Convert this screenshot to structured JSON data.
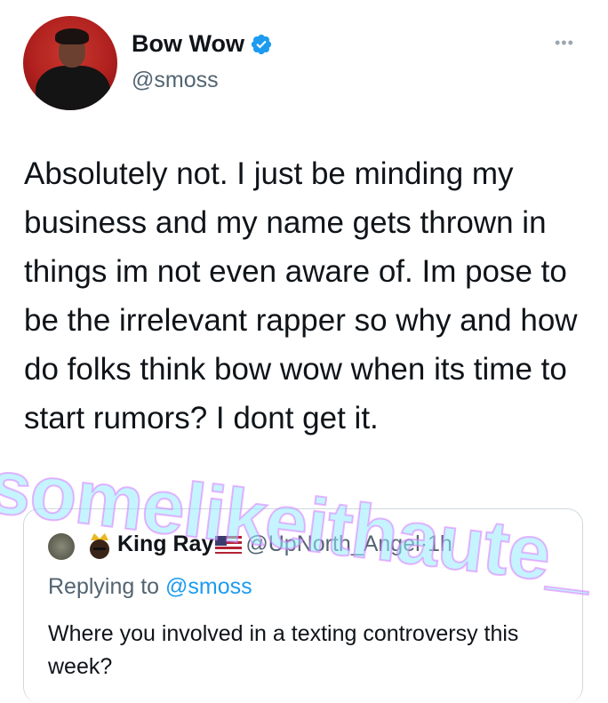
{
  "tweet": {
    "author_name": "Bow Wow",
    "author_handle": "@smoss",
    "verified": true,
    "more_icon": "more-horizontal-icon",
    "text": "Absolutely not. I just be minding my business and my name gets thrown in things im not even aware of. Im pose to be the irrelevant rapper so why and how do folks think bow wow when its time to start rumors? I dont get it."
  },
  "quoted_tweet": {
    "author_name": "King Ray",
    "flag_icon": "us-flag-icon",
    "author_handle": "@UpNorth_Angel",
    "separator": "·",
    "time": "1h",
    "replying_prefix": "Replying to",
    "replying_to": "@smoss",
    "text": "Where you involved in a texting controversy this week?"
  },
  "watermark": "somelikeithaute_",
  "colors": {
    "verified_blue": "#1d9bf0",
    "secondary_text": "#536471",
    "link_blue": "#1d9bf0",
    "watermark": "#96ebff"
  }
}
